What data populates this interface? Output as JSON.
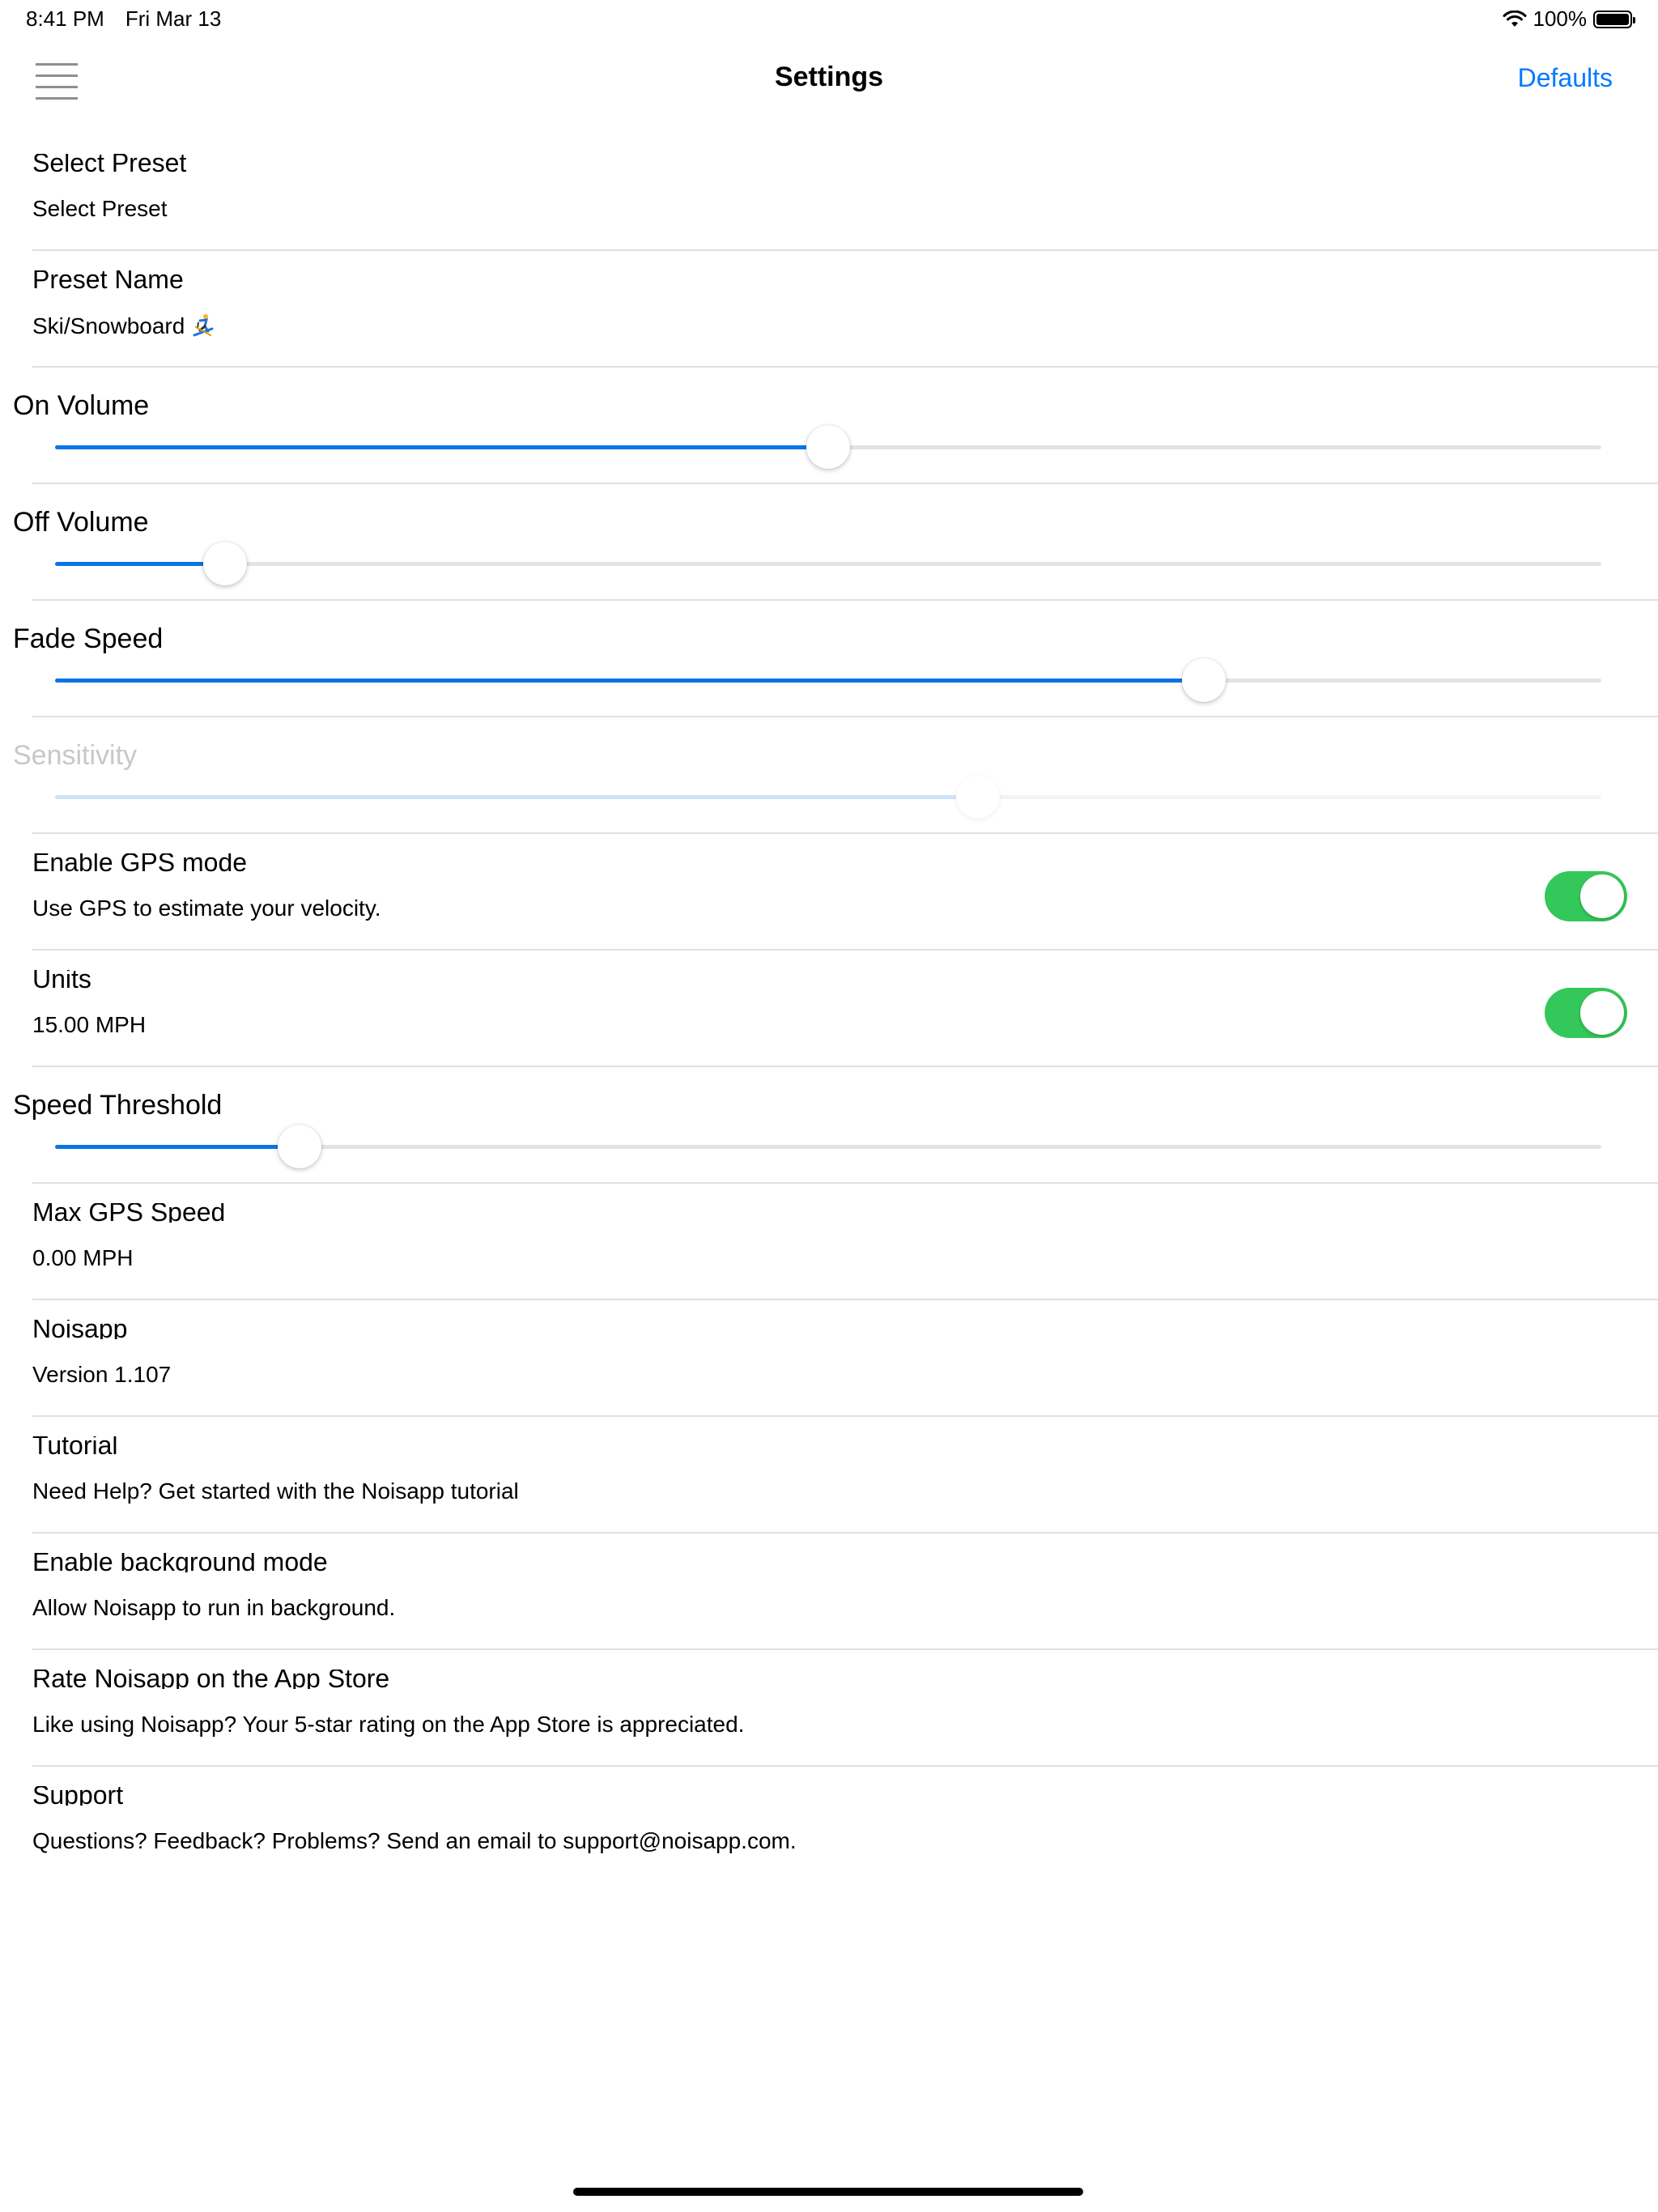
{
  "status_bar": {
    "time": "8:41 PM",
    "date": "Fri Mar 13",
    "battery": "100%",
    "battery_level": 1.0
  },
  "nav": {
    "title": "Settings",
    "action": "Defaults"
  },
  "accent_color": "#007aff",
  "slider_color": "#0a74e6",
  "toggle_on_color": "#34c759",
  "rows": {
    "select_preset": {
      "title": "Select Preset",
      "detail": "Select Preset"
    },
    "preset_name": {
      "title": "Preset Name",
      "detail": "Ski/Snowboard",
      "icon": "skier-icon"
    },
    "on_volume": {
      "title": "On Volume",
      "value": 0.5
    },
    "off_volume": {
      "title": "Off Volume",
      "value": 0.11
    },
    "fade_speed": {
      "title": "Fade Speed",
      "value": 0.743
    },
    "sensitivity": {
      "title": "Sensitivity",
      "value": 0.597,
      "enabled": false
    },
    "gps_mode": {
      "title": "Enable GPS mode",
      "detail": "Use GPS to estimate your velocity.",
      "toggle_on": true
    },
    "units": {
      "title": "Units",
      "detail": "15.00  MPH",
      "toggle_on": true
    },
    "speed_threshold": {
      "title": "Speed Threshold",
      "value": 0.158
    },
    "max_gps_speed": {
      "title": "Max GPS Speed",
      "detail": "0.00  MPH"
    },
    "app_version": {
      "title": "Noisapp",
      "detail": "Version 1.107"
    },
    "tutorial": {
      "title": "Tutorial",
      "detail": "Need Help? Get started with the Noisapp tutorial"
    },
    "background_mode": {
      "title": "Enable background mode",
      "detail": "Allow Noisapp to run in background."
    },
    "rate": {
      "title": "Rate Noisapp on the App Store",
      "detail": "Like using Noisapp? Your 5-star rating on the App Store is appreciated."
    },
    "support": {
      "title": "Support",
      "detail": "Questions? Feedback? Problems? Send an email to support@noisapp.com."
    }
  }
}
